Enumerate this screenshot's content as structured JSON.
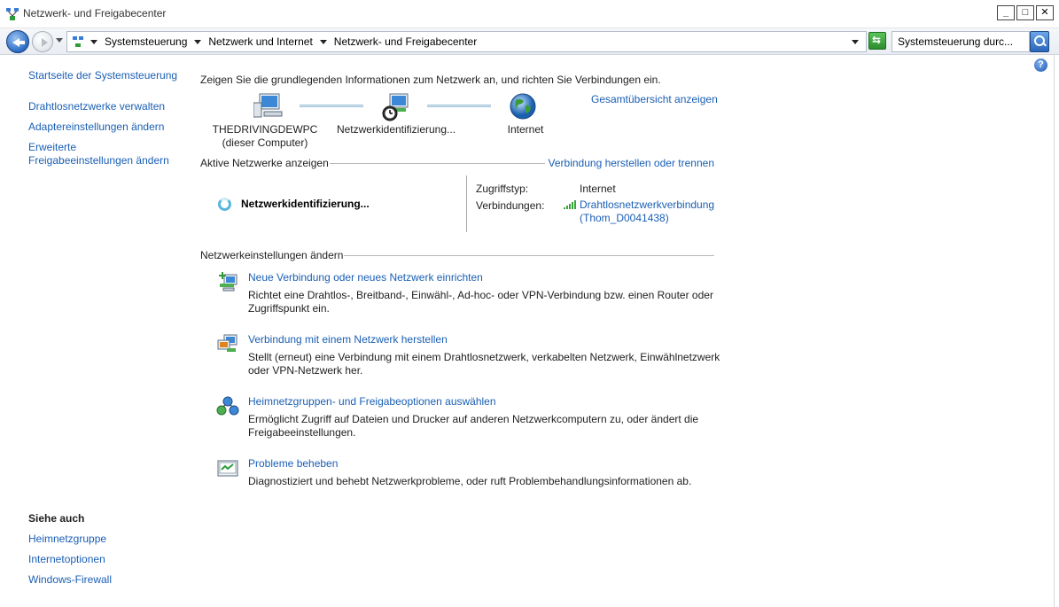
{
  "window": {
    "title": "Netzwerk- und Freigabecenter",
    "buttons": {
      "minimize": "_",
      "maximize": "□",
      "close": "✕"
    }
  },
  "addressbar": {
    "crumbs": [
      "Systemsteuerung",
      "Netzwerk und Internet",
      "Netzwerk- und Freigabecenter"
    ],
    "search_value": "Systemsteuerung durc..."
  },
  "sidebar": {
    "links": [
      "Startseite der Systemsteuerung",
      "Drahtlosnetzwerke verwalten",
      "Adaptereinstellungen ändern",
      "Erweiterte",
      "Freigabeeinstellungen ändern"
    ],
    "see_also_title": "Siehe auch",
    "see_also": [
      "Heimnetzgruppe",
      "Internetoptionen",
      "Windows-Firewall"
    ]
  },
  "main": {
    "intro": "Zeigen Sie die grundlegenden Informationen zum Netzwerk an, und richten Sie Verbindungen ein.",
    "overview_link": "Gesamtübersicht anzeigen",
    "map": {
      "computer_name": "THEDRIVINGDEWPC",
      "computer_sub": "(dieser Computer)",
      "network": "Netzwerkidentifizierung...",
      "internet": "Internet"
    },
    "active_title": "Aktive Netzwerke anzeigen",
    "active_link": "Verbindung herstellen oder trennen",
    "active": {
      "name": "Netzwerkidentifizierung...",
      "access_label": "Zugriffstyp:",
      "access_value": "Internet",
      "conn_label": "Verbindungen:",
      "conn_line1": "Drahtlosnetzwerkverbindung",
      "conn_line2": "(Thom_D0041438)"
    },
    "settings_title": "Netzwerkeinstellungen ändern",
    "tasks": [
      {
        "title": "Neue Verbindung oder neues Netzwerk einrichten",
        "desc": "Richtet eine Drahtlos-, Breitband-, Einwähl-, Ad-hoc- oder VPN-Verbindung bzw. einen Router oder Zugriffspunkt ein."
      },
      {
        "title": "Verbindung mit einem Netzwerk herstellen",
        "desc": "Stellt (erneut) eine Verbindung mit einem Drahtlosnetzwerk, verkabelten Netzwerk, Einwählnetzwerk oder VPN-Netzwerk her."
      },
      {
        "title": "Heimnetzgruppen- und Freigabeoptionen auswählen",
        "desc": "Ermöglicht Zugriff auf Dateien und Drucker auf anderen Netzwerkcomputern zu, oder ändert die Freigabeeinstellungen."
      },
      {
        "title": "Probleme beheben",
        "desc": "Diagnostiziert und behebt Netzwerkprobleme, oder ruft Problembehandlungsinformationen ab."
      }
    ]
  },
  "colors": {
    "link": "#1a5fb4",
    "text": "#1e1e1e"
  }
}
